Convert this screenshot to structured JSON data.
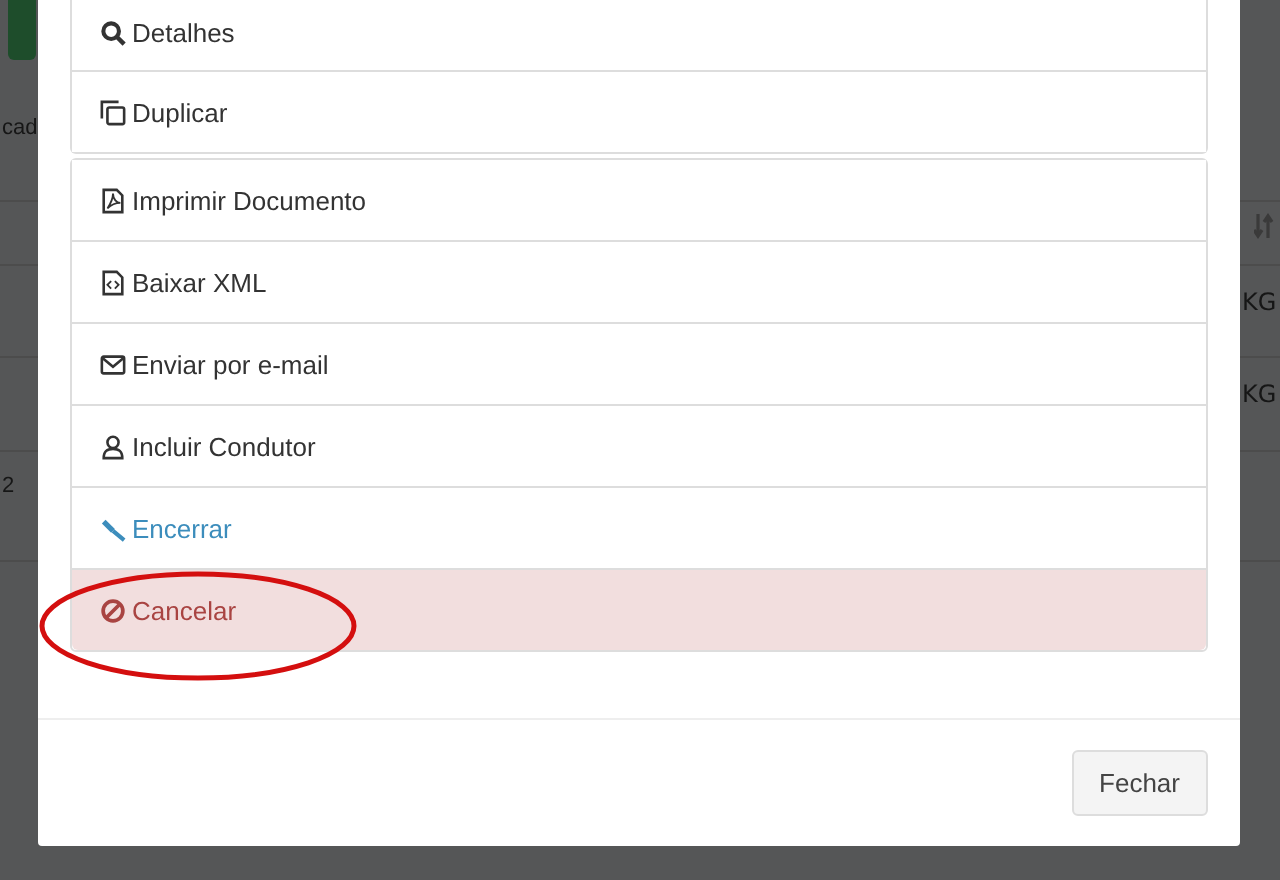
{
  "background": {
    "left_texts": [
      "cad",
      "2"
    ],
    "right_texts": [
      "KG",
      "KG"
    ]
  },
  "modal": {
    "groups": [
      {
        "items": [
          {
            "label": "Detalhes",
            "kind": "default"
          },
          {
            "label": "Duplicar",
            "kind": "default"
          }
        ]
      },
      {
        "items": [
          {
            "label": "Imprimir Documento",
            "kind": "default"
          },
          {
            "label": "Baixar XML",
            "kind": "default"
          },
          {
            "label": "Enviar por e-mail",
            "kind": "default"
          },
          {
            "label": "Incluir Condutor",
            "kind": "default"
          },
          {
            "label": "Encerrar",
            "kind": "link"
          },
          {
            "label": "Cancelar",
            "kind": "danger"
          }
        ]
      }
    ],
    "footer": {
      "buttons": [
        "Fechar"
      ]
    }
  }
}
